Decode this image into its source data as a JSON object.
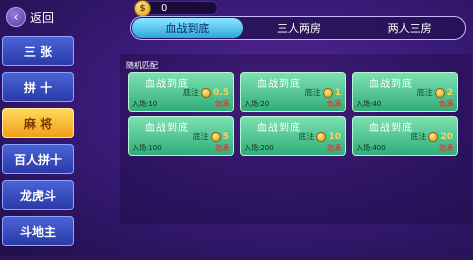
{
  "header": {
    "back_label": "返回",
    "coins": "0"
  },
  "tabs": [
    "血战到底",
    "三人两房",
    "两人三房"
  ],
  "sidebar": {
    "items": [
      {
        "label": "三 张"
      },
      {
        "label": "拼 十"
      },
      {
        "label": "麻 将"
      },
      {
        "label": "百人拼十"
      },
      {
        "label": "龙虎斗"
      },
      {
        "label": "斗地主"
      }
    ],
    "active_index": 2
  },
  "section_label": "随机匹配",
  "rooms": [
    {
      "title": "血战到底",
      "bet_label": "底注",
      "bet": "0.5",
      "entry": "入场:10",
      "status": "饱满"
    },
    {
      "title": "血战到底",
      "bet_label": "底注",
      "bet": "1",
      "entry": "入场:20",
      "status": "饱满"
    },
    {
      "title": "血战到底",
      "bet_label": "底注",
      "bet": "2",
      "entry": "入场:40",
      "status": "饱满"
    },
    {
      "title": "血战到底",
      "bet_label": "底注",
      "bet": "5",
      "entry": "入场:100",
      "status": "饱满"
    },
    {
      "title": "血战到底",
      "bet_label": "底注",
      "bet": "10",
      "entry": "入场:200",
      "status": "饱满"
    },
    {
      "title": "血战到底",
      "bet_label": "底注",
      "bet": "20",
      "entry": "入场:400",
      "status": "饱满"
    }
  ],
  "colors": {
    "background": "#3a1a78",
    "tab_active": "#2aa6e0",
    "sidebar_button": "#2a3aa8",
    "sidebar_active": "#f0a018",
    "room_card": "#2fae7a",
    "status_red": "#e02a2a"
  }
}
